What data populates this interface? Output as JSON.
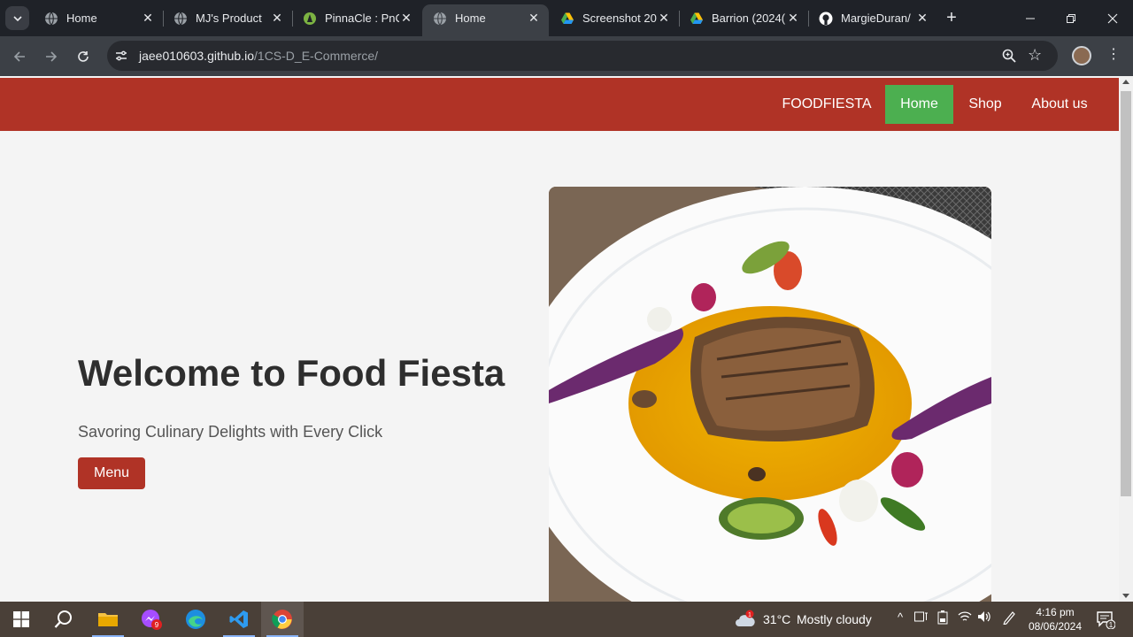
{
  "browser": {
    "tabs": [
      {
        "title": "Home",
        "icon": "globe-icon",
        "active": false
      },
      {
        "title": "MJ's Product",
        "icon": "globe-icon",
        "active": false
      },
      {
        "title": "PinnaCle : PnC",
        "icon": "pinnacle-icon",
        "active": false
      },
      {
        "title": "Home",
        "icon": "globe-icon",
        "active": true
      },
      {
        "title": "Screenshot 20",
        "icon": "google-drive-icon",
        "active": false
      },
      {
        "title": "Barrion (2024(",
        "icon": "google-drive-icon",
        "active": false
      },
      {
        "title": "MargieDuran/",
        "icon": "github-icon",
        "active": false
      }
    ],
    "url_host": "jaee010603.github.io",
    "url_path": "/1CS-D_E-Commerce/"
  },
  "site": {
    "nav": {
      "brand": "FOODFIESTA",
      "home": "Home",
      "shop": "Shop",
      "about": "About us"
    },
    "hero": {
      "title": "Welcome to Food Fiesta",
      "subtitle": "Savoring Culinary Delights with Every Click",
      "button": "Menu"
    },
    "colors": {
      "nav_bg": "#b03326",
      "active_nav": "#4caf50",
      "button_bg": "#b03326"
    }
  },
  "taskbar": {
    "weather_temp": "31°C",
    "weather_desc": "Mostly cloudy",
    "weather_badge": "1",
    "messenger_badge": "9",
    "time": "4:16 pm",
    "date": "08/06/2024",
    "notification_count": "1"
  }
}
